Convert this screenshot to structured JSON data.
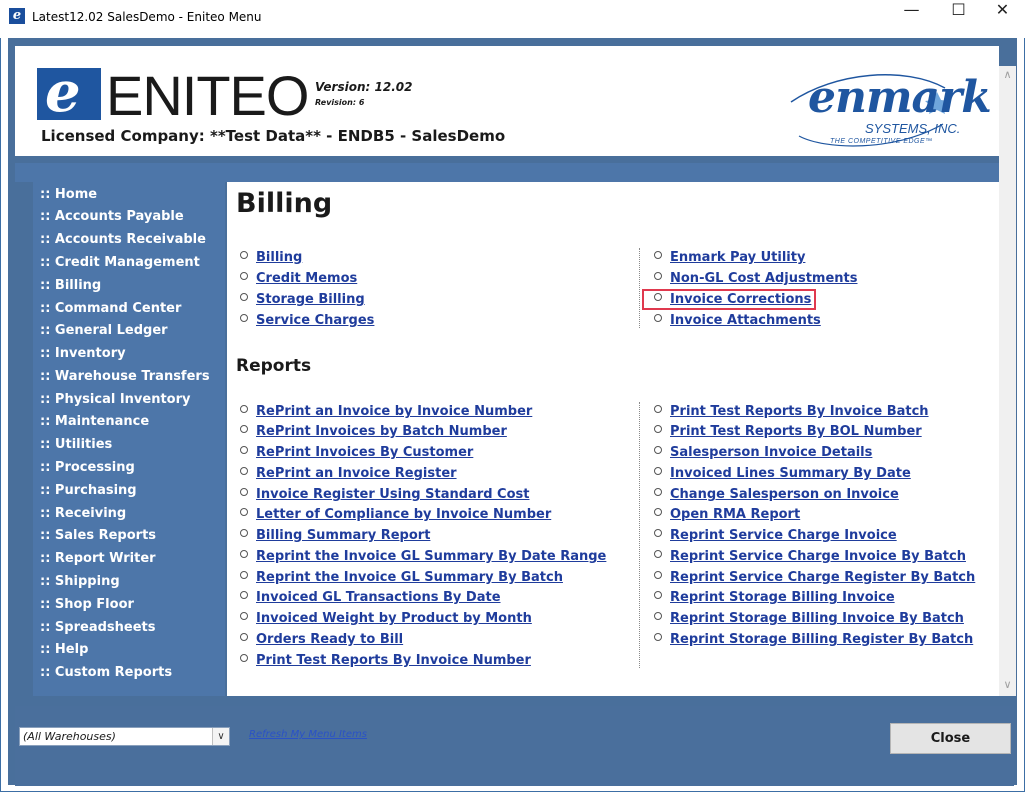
{
  "window": {
    "title": "Latest12.02 SalesDemo - Eniteo Menu",
    "minimize": "—",
    "maximize": "☐",
    "close": "✕"
  },
  "header": {
    "logo_letter": "e",
    "logo_word": "ENITEO",
    "version": "Version: 12.02",
    "revision": "Revision: 6",
    "licensed_company": "Licensed Company:  **Test Data** - ENDB5 - SalesDemo",
    "partner_logo_word": "enmark",
    "partner_logo_sub": "SYSTEMS, INC.",
    "partner_logo_tag": "THE COMPETITIVE EDGE™"
  },
  "sidebar": {
    "items": [
      ":: Home",
      ":: Accounts Payable",
      ":: Accounts Receivable",
      ":: Credit Management",
      ":: Billing",
      ":: Command Center",
      ":: General Ledger",
      ":: Inventory",
      ":: Warehouse Transfers",
      ":: Physical Inventory",
      ":: Maintenance",
      ":: Utilities",
      ":: Processing",
      ":: Purchasing",
      ":: Receiving",
      ":: Sales Reports",
      ":: Report Writer",
      ":: Shipping",
      ":: Shop Floor",
      ":: Spreadsheets",
      ":: Help",
      ":: Custom Reports"
    ]
  },
  "main": {
    "title": "Billing",
    "billing_left": [
      "Billing",
      "Credit Memos",
      "Storage Billing",
      "Service Charges"
    ],
    "billing_right": [
      "Enmark Pay Utility",
      "Non-GL Cost Adjustments",
      "Invoice Corrections",
      "Invoice Attachments"
    ],
    "reports_title": "Reports",
    "reports_left": [
      "RePrint an Invoice by Invoice Number",
      "RePrint Invoices by Batch Number",
      "RePrint Invoices By Customer",
      "RePrint an Invoice Register",
      "Invoice Register Using Standard Cost",
      "Letter of Compliance by Invoice Number",
      "Billing Summary Report",
      "Reprint the Invoice GL Summary By Date Range",
      "Reprint the Invoice GL Summary By Batch",
      "Invoiced GL Transactions By Date",
      "Invoiced Weight by Product by Month",
      "Orders Ready to Bill",
      "Print Test Reports By Invoice Number"
    ],
    "reports_right": [
      "Print Test Reports By Invoice Batch",
      "Print Test Reports By BOL Number",
      "Salesperson Invoice Details",
      "Invoiced Lines Summary By Date",
      "Change Salesperson on Invoice",
      "Open RMA Report",
      "Reprint Service Charge Invoice",
      "Reprint Service Charge Invoice By Batch",
      "Reprint Service Charge Register By Batch",
      "Reprint Storage Billing Invoice",
      "Reprint Storage Billing Invoice By Batch",
      "Reprint Storage Billing Register By Batch"
    ]
  },
  "footer": {
    "warehouse_value": "(All Warehouses)",
    "refresh_label": "Refresh My Menu Items",
    "close_label": "Close"
  },
  "colors": {
    "frame_blue": "#496f9b",
    "sidebar_blue": "#4d76a9",
    "link_blue": "#1f3c9c",
    "highlight_red": "#e0394e"
  }
}
